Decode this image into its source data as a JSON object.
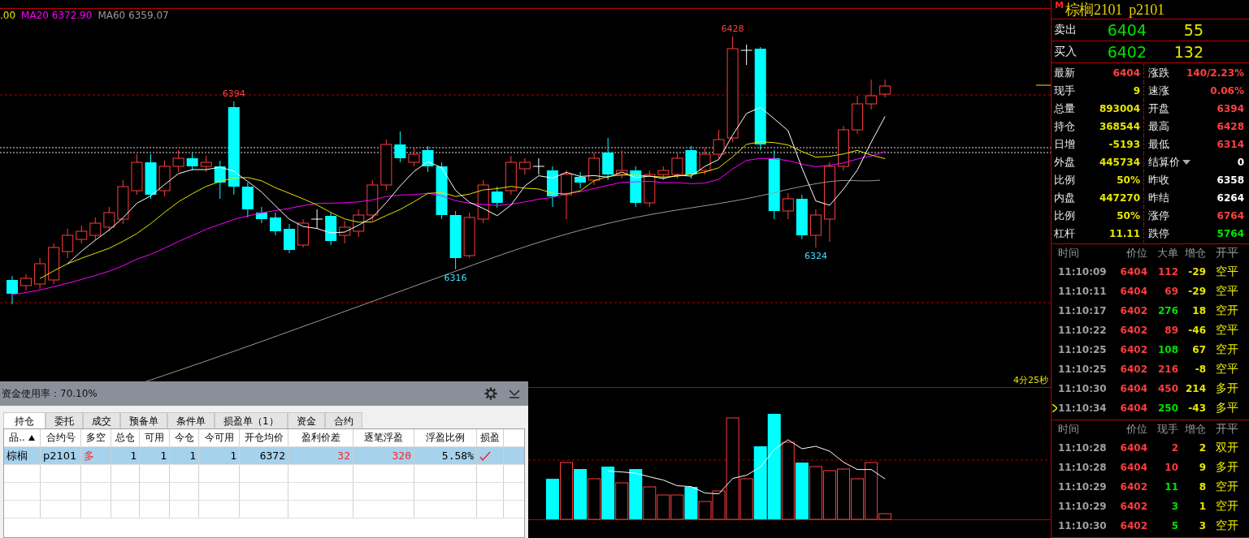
{
  "legend": [
    {
      "text": ".00",
      "color": "#e6e600"
    },
    {
      "text": "MA20 6372.90",
      "color": "#ff00ff"
    },
    {
      "text": "MA60 6359.07",
      "color": "#9a9a9a"
    }
  ],
  "chart": {
    "extreme_labels": [
      {
        "text": "6394",
        "kind": "high"
      },
      {
        "text": "6316",
        "kind": "low"
      },
      {
        "text": "6428",
        "kind": "high"
      },
      {
        "text": "6324",
        "kind": "low"
      }
    ],
    "countdown": "4分25秒"
  },
  "quote": {
    "mark": "M",
    "title": "棕榈2101  p2101",
    "book": [
      {
        "label": "卖出",
        "price": "6404",
        "volume": "55"
      },
      {
        "label": "买入",
        "price": "6402",
        "volume": "132"
      }
    ],
    "stats": [
      [
        {
          "label": "最新",
          "value": "6404",
          "color": "#ff4040"
        },
        {
          "label": "涨跌",
          "value": "140/2.23%",
          "color": "#ff4040"
        }
      ],
      [
        {
          "label": "现手",
          "value": "9",
          "color": "#e6e600"
        },
        {
          "label": "速涨",
          "value": "0.06%",
          "color": "#ff4040"
        }
      ],
      [
        {
          "label": "总量",
          "value": "893004",
          "color": "#e6e600"
        },
        {
          "label": "开盘",
          "value": "6394",
          "color": "#ff4040"
        }
      ],
      [
        {
          "label": "持仓",
          "value": "368544",
          "color": "#e6e600"
        },
        {
          "label": "最高",
          "value": "6428",
          "color": "#ff4040"
        }
      ],
      [
        {
          "label": "日增",
          "value": "-5193",
          "color": "#e6e600"
        },
        {
          "label": "最低",
          "value": "6314",
          "color": "#ff4040"
        }
      ],
      [
        {
          "label": "外盘",
          "value": "445734",
          "color": "#e6e600"
        },
        {
          "label": "结算价",
          "value": "0",
          "color": "#ffffff",
          "dropdown": true
        }
      ],
      [
        {
          "label": "比例",
          "value": "50%",
          "color": "#e6e600"
        },
        {
          "label": "昨收",
          "value": "6358",
          "color": "#ffffff"
        }
      ],
      [
        {
          "label": "内盘",
          "value": "447270",
          "color": "#e6e600"
        },
        {
          "label": "昨结",
          "value": "6264",
          "color": "#ffffff"
        }
      ],
      [
        {
          "label": "比例",
          "value": "50%",
          "color": "#e6e600"
        },
        {
          "label": "涨停",
          "value": "6764",
          "color": "#ff4040"
        }
      ],
      [
        {
          "label": "杠杆",
          "value": "11.11",
          "color": "#e6e600"
        },
        {
          "label": "跌停",
          "value": "5764",
          "color": "#00e600"
        }
      ]
    ]
  },
  "big_orders": {
    "columns": [
      "时间",
      "价位",
      "大单",
      "增仓",
      "开平"
    ],
    "rows": [
      {
        "time": "11:10:09",
        "price": "6404",
        "size": "112",
        "oi": "-29",
        "type": "空平",
        "color": "#ff3c3c",
        "current": false
      },
      {
        "time": "11:10:11",
        "price": "6404",
        "size": "69",
        "oi": "-29",
        "type": "空平",
        "color": "#ff3c3c",
        "current": false
      },
      {
        "time": "11:10:17",
        "price": "6402",
        "size": "276",
        "oi": "18",
        "type": "空开",
        "color": "#00e000",
        "current": false
      },
      {
        "time": "11:10:22",
        "price": "6402",
        "size": "89",
        "oi": "-46",
        "type": "空平",
        "color": "#ff3c3c",
        "current": false
      },
      {
        "time": "11:10:25",
        "price": "6402",
        "size": "108",
        "oi": "67",
        "type": "空开",
        "color": "#00e000",
        "current": false
      },
      {
        "time": "11:10:25",
        "price": "6402",
        "size": "216",
        "oi": "-8",
        "type": "空平",
        "color": "#ff3c3c",
        "current": false
      },
      {
        "time": "11:10:30",
        "price": "6404",
        "size": "450",
        "oi": "214",
        "type": "多开",
        "color": "#ff3c3c",
        "current": false
      },
      {
        "time": "11:10:34",
        "price": "6404",
        "size": "250",
        "oi": "-43",
        "type": "多平",
        "color": "#00e000",
        "current": true
      }
    ]
  },
  "ticks": {
    "columns": [
      "时间",
      "价位",
      "现手",
      "增仓",
      "开平"
    ],
    "rows": [
      {
        "time": "11:10:28",
        "price": "6404",
        "size": "2",
        "oi": "2",
        "type": "双开",
        "color": "#ff3c3c"
      },
      {
        "time": "11:10:28",
        "price": "6404",
        "size": "10",
        "oi": "9",
        "type": "多开",
        "color": "#ff3c3c"
      },
      {
        "time": "11:10:29",
        "price": "6402",
        "size": "11",
        "oi": "8",
        "type": "空开",
        "color": "#00e000"
      },
      {
        "time": "11:10:29",
        "price": "6402",
        "size": "3",
        "oi": "1",
        "type": "空开",
        "color": "#00e000"
      },
      {
        "time": "11:10:30",
        "price": "6402",
        "size": "5",
        "oi": "3",
        "type": "空开",
        "color": "#00e000"
      }
    ]
  },
  "positions": {
    "usage": "资金使用率：70.10%",
    "tabs": [
      {
        "label": "持仓",
        "selected": true
      },
      {
        "label": "委托",
        "selected": false
      },
      {
        "label": "成交",
        "selected": false
      },
      {
        "label": "预备单",
        "selected": false
      },
      {
        "label": "条件单",
        "selected": false
      },
      {
        "label": "损盈单（1）",
        "selected": false
      },
      {
        "label": "资金",
        "selected": false
      },
      {
        "label": "合约",
        "selected": false
      }
    ],
    "columns": [
      {
        "label": "品..",
        "sorted": true
      },
      {
        "label": "合约号"
      },
      {
        "label": "多空"
      },
      {
        "label": "总仓"
      },
      {
        "label": "可用"
      },
      {
        "label": "今仓"
      },
      {
        "label": "今可用"
      },
      {
        "label": "开仓均价"
      },
      {
        "label": "盈利价差"
      },
      {
        "label": "逐笔浮盈"
      },
      {
        "label": "浮盈比例"
      },
      {
        "label": "损盈"
      }
    ],
    "rows": [
      {
        "selected": true,
        "cells": [
          {
            "kind": "text",
            "text": "棕榈"
          },
          {
            "kind": "text",
            "text": "p2101"
          },
          {
            "kind": "text",
            "text": "多",
            "color": "#ff2020"
          },
          {
            "kind": "text",
            "text": "1"
          },
          {
            "kind": "text",
            "text": "1"
          },
          {
            "kind": "text",
            "text": "1"
          },
          {
            "kind": "text",
            "text": "1"
          },
          {
            "kind": "text",
            "text": "6372"
          },
          {
            "kind": "text",
            "text": "32",
            "color": "#ff2020"
          },
          {
            "kind": "text",
            "text": "320",
            "color": "#ff2020"
          },
          {
            "kind": "text",
            "text": "5.58%"
          },
          {
            "kind": "check",
            "color": "#ff2020"
          }
        ]
      }
    ]
  }
}
